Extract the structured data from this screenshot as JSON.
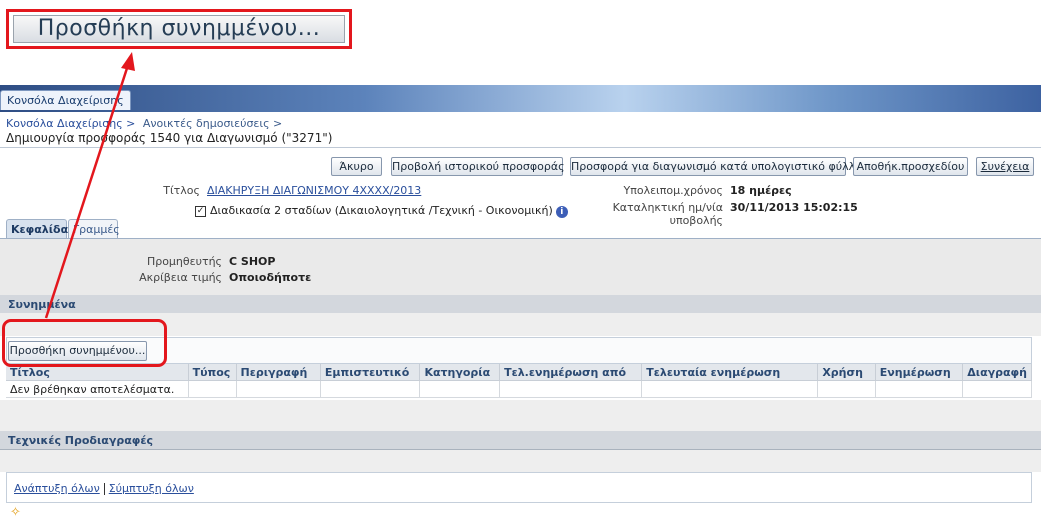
{
  "zoom": {
    "label": "Προσθήκη συνημμένου..."
  },
  "app": {
    "tab": "Κονσόλα Διαχείρισης"
  },
  "breadcrumb": {
    "item1": "Κονσόλα Διαχείρισης >",
    "item2": "Ανοικτές δημοσιεύσεις >"
  },
  "page_title": "Δημιουργία προσφοράς 1540 για Διαγωνισμό (\"3271\")",
  "buttons": {
    "cancel": "Άκυρο",
    "history": "Προβολή ιστορικού προσφοράς",
    "spreadsheet": "Προσφορά για διαγωνισμό κατά υπολογιστικό φύλλο",
    "save_draft": "Αποθήκ.προσχεδίου",
    "continue": "Συνέχεια"
  },
  "header": {
    "title_label": "Τίτλος",
    "title_value": "ΔΙΑΚΗΡΥΞΗ ΔΙΑΓΩΝΙΣΜΟΥ 4ΧΧΧΧ/2013",
    "two_stage": "Διαδικασία 2 σταδίων (Δικαιολογητικά /Τεχνική - Οικονομική)",
    "remaining_label": "Υπολειπομ.χρόνος",
    "remaining_value": "18 ημέρες",
    "deadline_label": "Καταληκτική ημ/νία υποβολής",
    "deadline_value": "30/11/2013 15:02:15"
  },
  "tabs": {
    "header": "Κεφαλίδα",
    "lines": "Γραμμές"
  },
  "details": {
    "supplier_label": "Προμηθευτής",
    "supplier_value": "C SHOP",
    "price_label": "Ακρίβεια τιμής",
    "price_value": "Οποιοδήποτε"
  },
  "attachments": {
    "section_title": "Συνημμένα",
    "add_button": "Προσθήκη συνημμένου...",
    "columns": [
      "Τίτλος",
      "Τύπος",
      "Περιγραφή",
      "Εμπιστευτικό",
      "Κατηγορία",
      "Τελ.ενημέρωση από",
      "Τελευταία ενημέρωση",
      "Χρήση",
      "Ενημέρωση",
      "Διαγραφή"
    ],
    "empty": "Δεν βρέθηκαν αποτελέσματα."
  },
  "tech_specs": {
    "section_title": "Τεχνικές Προδιαγραφές",
    "expand_all": "Ανάπτυξη όλων",
    "collapse_all": "Σύμπτυξη όλων"
  },
  "colors": {
    "highlight": "#e3171d",
    "header_bar": "#2e4d84",
    "link": "#2a4f9c"
  }
}
